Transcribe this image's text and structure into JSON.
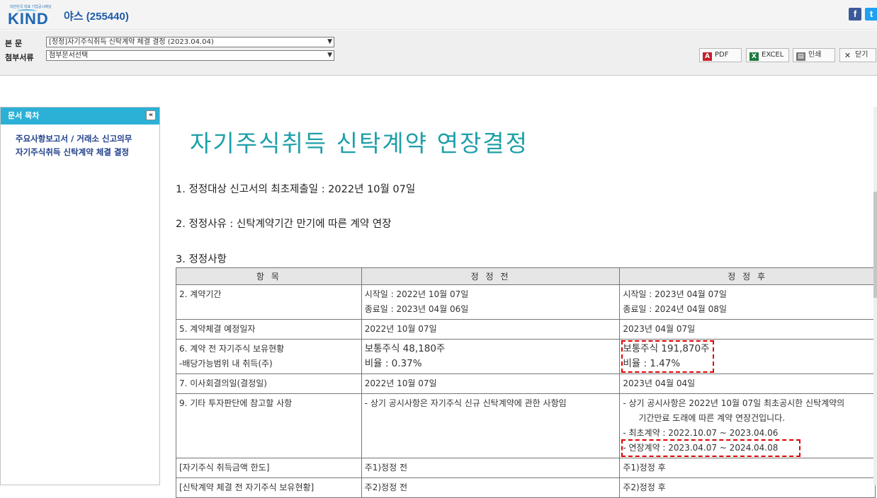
{
  "header": {
    "logo_tagline": "대한민국 대표 기업공시채널",
    "logo_text": "KIND",
    "company": "야스 (255440)"
  },
  "social": {
    "facebook": "f",
    "twitter": "t"
  },
  "toolbar": {
    "main_label": "본 문",
    "main_select": "[정정]자기주식취득 신탁계약 체결 결정 (2023.04.04)",
    "attach_label": "첨부서류",
    "attach_select": "첨부문서선택",
    "pdf": "PDF",
    "excel": "EXCEL",
    "print": "인쇄",
    "close": "닫기"
  },
  "sidebar": {
    "title": "문서 목차",
    "items": [
      "주요사항보고서 / 거래소 신고의무",
      "자기주식취득 신탁계약 체결 결정"
    ]
  },
  "document": {
    "title": "자기주식취득 신탁계약 연장결정",
    "line1": "1. 정정대상 신고서의 최초제출일 : 2022년 10월 07일",
    "line2": "2. 정정사유 : 신탁계약기간 만기에 따른 계약 연장",
    "line3": "3. 정정사항",
    "table": {
      "headers": [
        "항 목",
        "정 정 전",
        "정 정 후"
      ],
      "r1": {
        "item": "2. 계약기간",
        "before": [
          "시작일 : 2022년 10월 07일",
          "종료일 : 2023년 04월 06일"
        ],
        "after": [
          "시작일 : 2023년 04월 07일",
          "종료일 : 2024년 04월 08일"
        ]
      },
      "r2": {
        "item": "5. 계약체결 예정일자",
        "before": "2022년 10월 07일",
        "after": "2023년 04월 07일"
      },
      "r3": {
        "item": [
          "6. 계약 전  자기주식 보유현황",
          "-배당가능범위 내 취득(주)"
        ],
        "before": [
          "보통주식 48,180주",
          "비율 : 0.37%"
        ],
        "after": [
          "보통주식 191,870주",
          "비율 : 1.47%"
        ]
      },
      "r4": {
        "item": "7. 이사회결의일(결정일)",
        "before": "2022년 10월 07일",
        "after": "2023년 04월 04일"
      },
      "r5": {
        "item": "9. 기타 투자판단에 참고할 사항",
        "before": "- 상기 공시사항은 자기주식 신규 신탁계약에 관한 사항임",
        "after": [
          "- 상기 공시사항은 2022년 10월 07일 최초공시한 신탁계약의",
          "기간만료 도래에 따른 계약 연장건입니다.",
          "- 최초계약 : 2022.10.07 ~ 2023.04.06",
          "- 연장계약 : 2023.04.07 ~ 2024.04.08"
        ]
      },
      "r6": {
        "item": "[자기주식 취득금액 한도]",
        "before": "주1)정정 전",
        "after": "주1)정정 후"
      },
      "r7": {
        "item": "[신탁계약 체결 전 자기주식 보유현황]",
        "before": "주2)정정 전",
        "after": "주2)정정 후"
      }
    }
  }
}
